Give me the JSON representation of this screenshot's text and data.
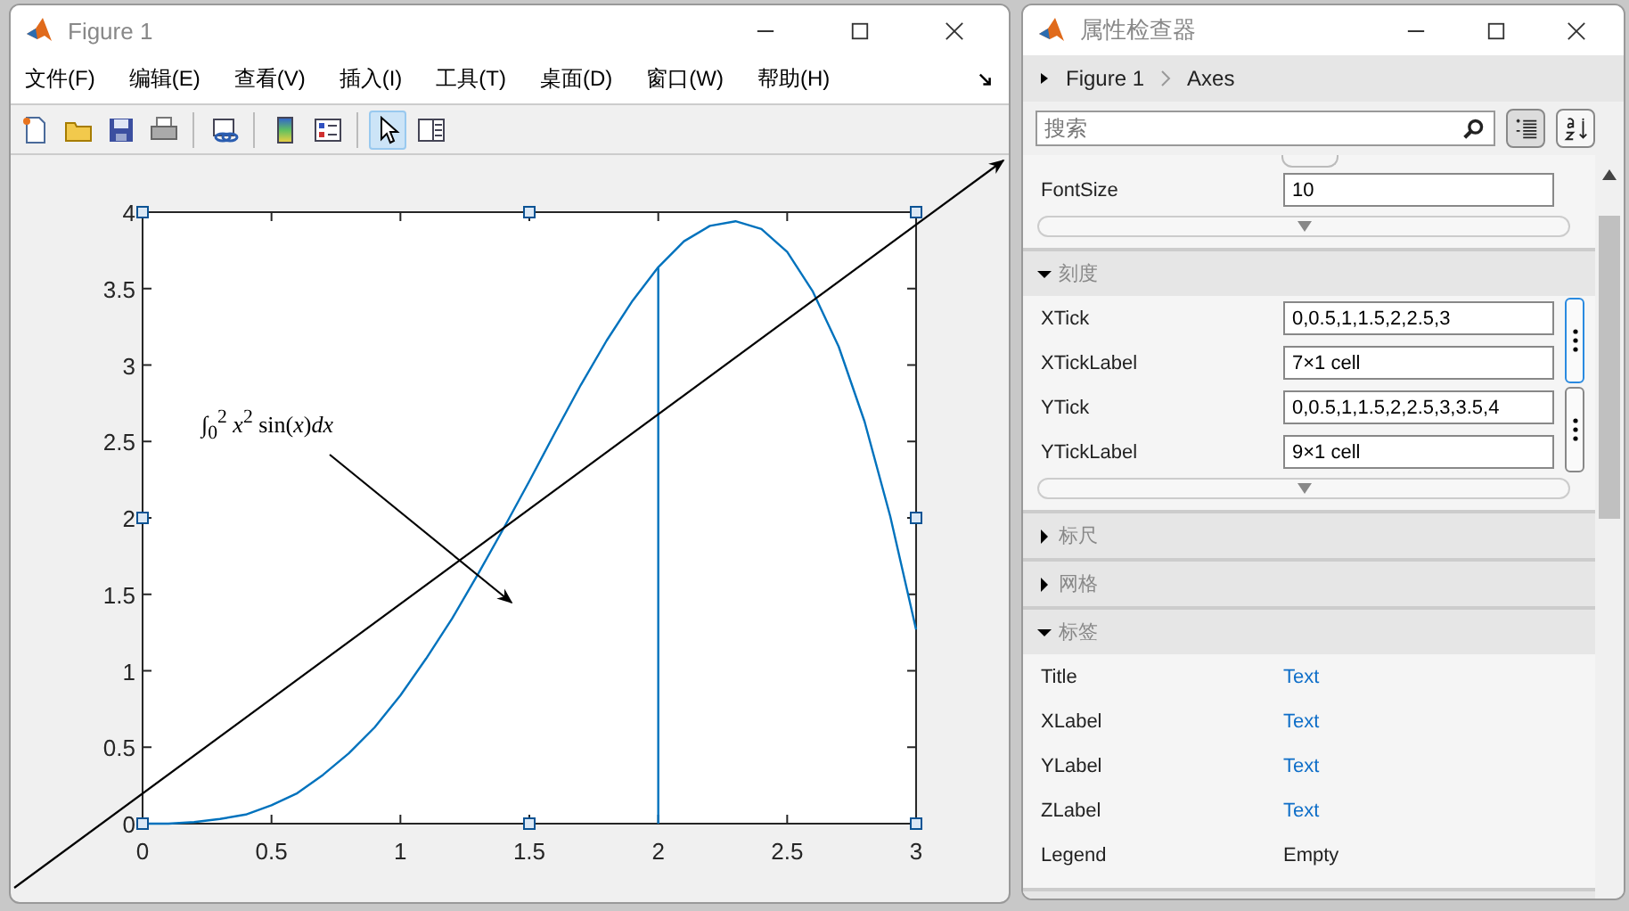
{
  "figure_window": {
    "title": "Figure 1",
    "menu": [
      "文件(F)",
      "编辑(E)",
      "查看(V)",
      "插入(I)",
      "工具(T)",
      "桌面(D)",
      "窗口(W)",
      "帮助(H)"
    ],
    "toolbar": [
      {
        "kind": "new",
        "selected": false
      },
      {
        "kind": "open",
        "selected": false
      },
      {
        "kind": "save",
        "selected": false
      },
      {
        "kind": "print",
        "selected": false
      },
      {
        "kind": "link",
        "selected": false
      },
      {
        "kind": "colorbar",
        "selected": false
      },
      {
        "kind": "legend",
        "selected": false
      },
      {
        "kind": "pointer",
        "selected": true
      },
      {
        "kind": "property-editor",
        "selected": false
      }
    ],
    "chart_data": {
      "type": "line",
      "x": [
        0,
        0.1,
        0.2,
        0.3,
        0.4,
        0.5,
        0.6,
        0.7,
        0.8,
        0.9,
        1,
        1.1,
        1.2,
        1.3,
        1.4,
        1.5,
        1.6,
        1.7,
        1.8,
        1.9,
        2,
        2.1,
        2.2,
        2.3,
        2.4,
        2.5,
        2.6,
        2.7,
        2.8,
        2.9,
        3
      ],
      "series": [
        {
          "color": "#0072bd",
          "values": [
            0,
            0,
            0.01,
            0.03,
            0.06,
            0.12,
            0.2,
            0.32,
            0.46,
            0.63,
            0.84,
            1.08,
            1.34,
            1.63,
            1.93,
            2.24,
            2.56,
            2.87,
            3.16,
            3.42,
            3.64,
            3.81,
            3.91,
            3.94,
            3.89,
            3.74,
            3.48,
            3.12,
            2.63,
            2.01,
            1.27
          ]
        }
      ],
      "xlim": [
        0,
        3
      ],
      "ylim": [
        0,
        4
      ],
      "xticks": [
        0,
        0.5,
        1,
        1.5,
        2,
        2.5,
        3
      ],
      "yticks": [
        0,
        0.5,
        1,
        1.5,
        2,
        2.5,
        3,
        3.5,
        4
      ]
    },
    "annotation": {
      "text": "∫$_{0}$$^{2}$ *x*$^{2}$ sin(*x*)*dx*"
    }
  },
  "inspector": {
    "title": "属性检查器",
    "breadcrumb": [
      "Figure 1",
      "Axes"
    ],
    "search": {
      "placeholder": "搜索"
    },
    "view_buttons": [
      {
        "kind": "grouped",
        "selected": true
      },
      {
        "kind": "alphabetical",
        "selected": false
      }
    ],
    "sections": [
      {
        "more": true,
        "groups": [
          {
            "rows": [
              {
                "label": "FontSize",
                "value": "10",
                "kind": "field"
              }
            ]
          }
        ]
      },
      {
        "title": "刻度",
        "expanded": true,
        "more": true,
        "groups": [
          {
            "button": true,
            "focused": true,
            "rows": [
              {
                "label": "XTick",
                "value": "0,0.5,1,1.5,2,2.5,3",
                "kind": "field"
              },
              {
                "label": "XTickLabel",
                "value": "7×1 cell",
                "kind": "field"
              }
            ]
          },
          {
            "button": true,
            "focused": false,
            "rows": [
              {
                "label": "YTick",
                "value": "0,0.5,1,1.5,2,2.5,3,3.5,4",
                "kind": "field"
              },
              {
                "label": "YTickLabel",
                "value": "9×1 cell",
                "kind": "field"
              }
            ]
          }
        ]
      },
      {
        "title": "标尺",
        "expanded": false
      },
      {
        "title": "网格",
        "expanded": false
      },
      {
        "title": "标签",
        "expanded": true,
        "groups": [
          {
            "rows": [
              {
                "label": "Title",
                "value": "Text",
                "kind": "link"
              },
              {
                "label": "XLabel",
                "value": "Text",
                "kind": "link"
              },
              {
                "label": "YLabel",
                "value": "Text",
                "kind": "link"
              },
              {
                "label": "ZLabel",
                "value": "Text",
                "kind": "link"
              },
              {
                "label": "Legend",
                "value": "Empty",
                "kind": "text"
              }
            ]
          }
        ]
      }
    ]
  }
}
